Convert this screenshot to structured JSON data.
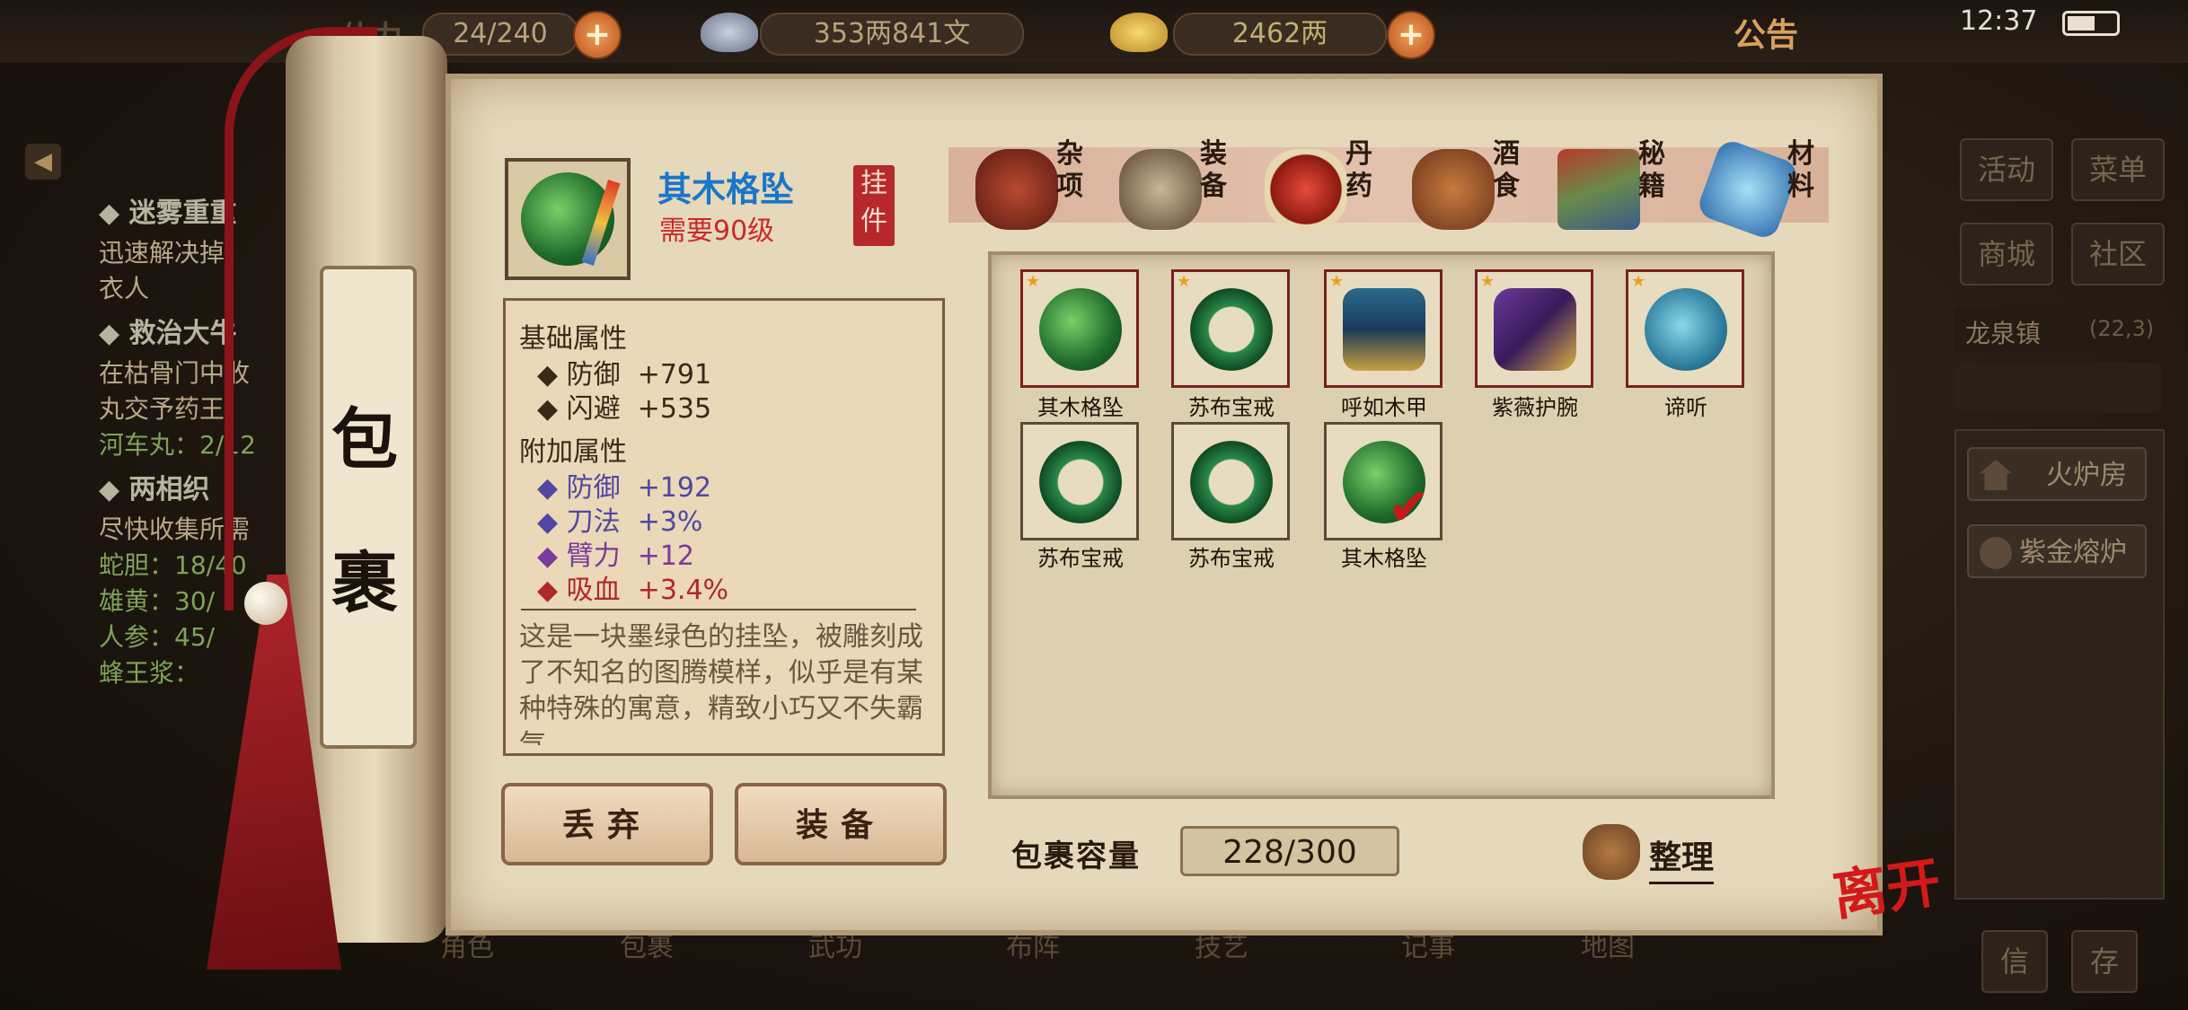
{
  "status": {
    "time": "12:37",
    "notice_label": "公告"
  },
  "resources": {
    "stamina_label": "体力",
    "stamina": "24/240",
    "silver": "353两841文",
    "gold": "2462两"
  },
  "quests": [
    {
      "title": "迷雾重重",
      "lines": [
        "迅速解决掉",
        "衣人"
      ]
    },
    {
      "title": "救治大牛",
      "lines": [
        "在枯骨门中收",
        "丸交予药王"
      ],
      "progress": [
        "河车丸：2/12"
      ]
    },
    {
      "title": "两相织",
      "lines": [
        "尽快收集所需"
      ],
      "progress": [
        "蛇胆：18/40",
        "雄黄：30/",
        "人参：45/",
        "蜂王浆："
      ]
    }
  ],
  "right_menu": {
    "buttons": [
      "活动",
      "菜单",
      "商城",
      "社区"
    ],
    "location": "龙泉镇",
    "coords": "(22,3)",
    "facilities": [
      "火炉房",
      "紫金熔炉"
    ],
    "bottom": [
      "信",
      "存"
    ]
  },
  "bottom_nav": [
    "角色",
    "包裹",
    "武功",
    "布阵",
    "技艺",
    "记事",
    "地图"
  ],
  "scroll_title": [
    "包",
    "裹"
  ],
  "selected_item": {
    "name": "其木格坠",
    "requirement": "需要90级",
    "type_seal": "挂件",
    "base_header": "基础属性",
    "base_stats": [
      {
        "name": "防御",
        "value": "+791"
      },
      {
        "name": "闪避",
        "value": "+535"
      }
    ],
    "extra_header": "附加属性",
    "extra_stats": [
      {
        "name": "防御",
        "value": "+192",
        "color": "#5048a0"
      },
      {
        "name": "刀法",
        "value": "+3%",
        "color": "#5048a0"
      },
      {
        "name": "臂力",
        "value": "+12",
        "color": "#7a3a9a"
      },
      {
        "name": "吸血",
        "value": "+3.4%",
        "color": "#b02828"
      }
    ],
    "description": "这是一块墨绿色的挂坠，被雕刻成了不知名的图腾模样，似乎是有某种特殊的寓意，精致小巧又不失霸气"
  },
  "actions": {
    "discard": "丢弃",
    "equip": "装备"
  },
  "categories": [
    {
      "label": "杂项",
      "icon": "jar-icon"
    },
    {
      "label": "装备",
      "icon": "equipment-icon"
    },
    {
      "label": "丹药",
      "icon": "pill-icon"
    },
    {
      "label": "酒食",
      "icon": "wine-food-icon"
    },
    {
      "label": "秘籍",
      "icon": "book-icon"
    },
    {
      "label": "材料",
      "icon": "crystal-icon"
    }
  ],
  "items": [
    {
      "name": "其木格坠",
      "icon": "jade-pendant-icon",
      "starred": true
    },
    {
      "name": "苏布宝戒",
      "icon": "jade-ring-icon",
      "starred": true
    },
    {
      "name": "呼如木甲",
      "icon": "armor-icon",
      "starred": true
    },
    {
      "name": "紫薇护腕",
      "icon": "bracer-icon",
      "starred": true
    },
    {
      "name": "谛听",
      "icon": "beast-charm-icon",
      "starred": true
    },
    {
      "name": "苏布宝戒",
      "icon": "jade-ring-icon",
      "starred": false
    },
    {
      "name": "苏布宝戒",
      "icon": "jade-ring-icon",
      "starred": false
    },
    {
      "name": "其木格坠",
      "icon": "jade-pendant-icon",
      "starred": false,
      "equipped": true
    }
  ],
  "capacity": {
    "label": "包裹容量",
    "value": "228/300"
  },
  "sort_label": "整理",
  "leave_label": "离开"
}
